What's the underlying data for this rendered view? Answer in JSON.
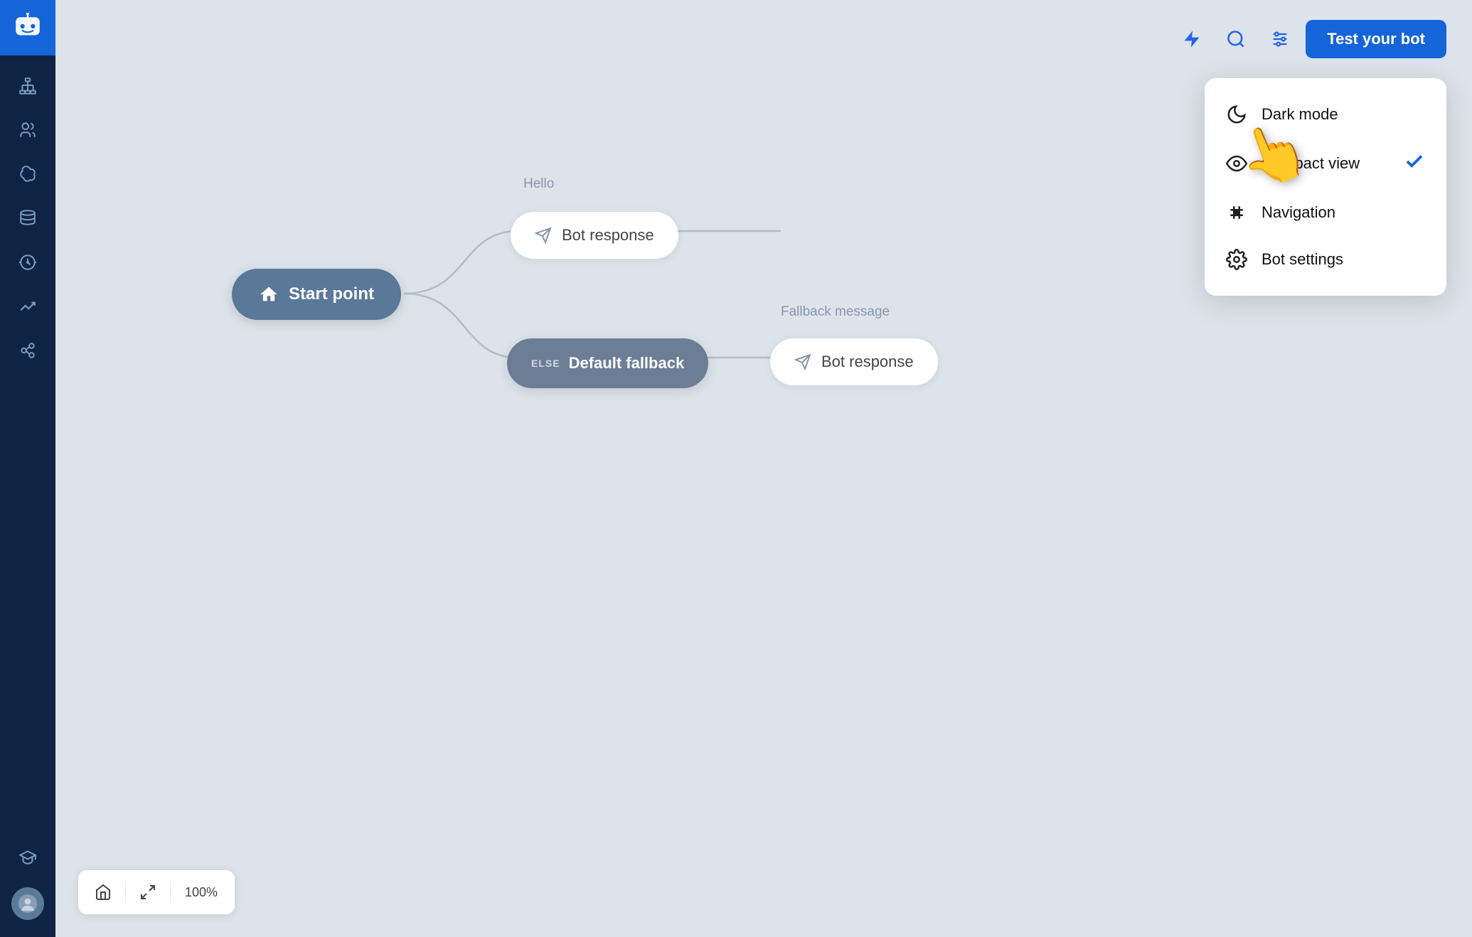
{
  "app": {
    "logo_icon": "chat-bot-icon"
  },
  "sidebar": {
    "items": [
      {
        "id": "hierarchy",
        "label": "Hierarchy",
        "icon": "hierarchy-icon"
      },
      {
        "id": "users",
        "label": "Users",
        "icon": "users-icon"
      },
      {
        "id": "brain",
        "label": "AI/NLP",
        "icon": "brain-icon"
      },
      {
        "id": "database",
        "label": "Database",
        "icon": "database-icon"
      },
      {
        "id": "history",
        "label": "History",
        "icon": "history-icon"
      },
      {
        "id": "analytics",
        "label": "Analytics",
        "icon": "analytics-icon"
      },
      {
        "id": "integrations",
        "label": "Integrations",
        "icon": "integrations-icon"
      }
    ],
    "bottom": {
      "academy_icon": "graduation-cap-icon",
      "avatar_label": "User avatar"
    }
  },
  "toolbar": {
    "lightning_btn_label": "Lightning",
    "search_btn_label": "Search",
    "settings_btn_label": "Settings",
    "test_bot_label": "Test your bot"
  },
  "dropdown": {
    "items": [
      {
        "id": "dark-mode",
        "label": "Dark mode",
        "icon": "moon-icon",
        "checked": false
      },
      {
        "id": "compact-view",
        "label": "Compact view",
        "icon": "eye-icon",
        "checked": true
      },
      {
        "id": "navigation",
        "label": "Navigation",
        "icon": "navigation-icon",
        "checked": false
      },
      {
        "id": "bot-settings",
        "label": "Bot settings",
        "icon": "gear-icon",
        "checked": false
      }
    ]
  },
  "canvas": {
    "nodes": {
      "start": {
        "label": "Start point",
        "icon": "home-icon"
      },
      "hello_response": {
        "flow_label": "Hello",
        "label": "Bot response",
        "icon": "send-icon"
      },
      "fallback": {
        "else_badge": "ELSE",
        "label": "Default fallback",
        "icon": "else-icon"
      },
      "fallback_response": {
        "flow_label": "Fallback message",
        "label": "Bot response",
        "icon": "send-icon"
      }
    }
  },
  "bottom_bar": {
    "home_btn_label": "Home",
    "fullscreen_btn_label": "Fullscreen",
    "zoom_level": "100%"
  },
  "colors": {
    "accent": "#1565d8",
    "sidebar_bg": "#0f2444",
    "sidebar_icon": "#7a9cc4",
    "node_start_bg": "#5a7898",
    "node_fallback_bg": "#6b7e96",
    "canvas_bg": "#dde3ea"
  }
}
